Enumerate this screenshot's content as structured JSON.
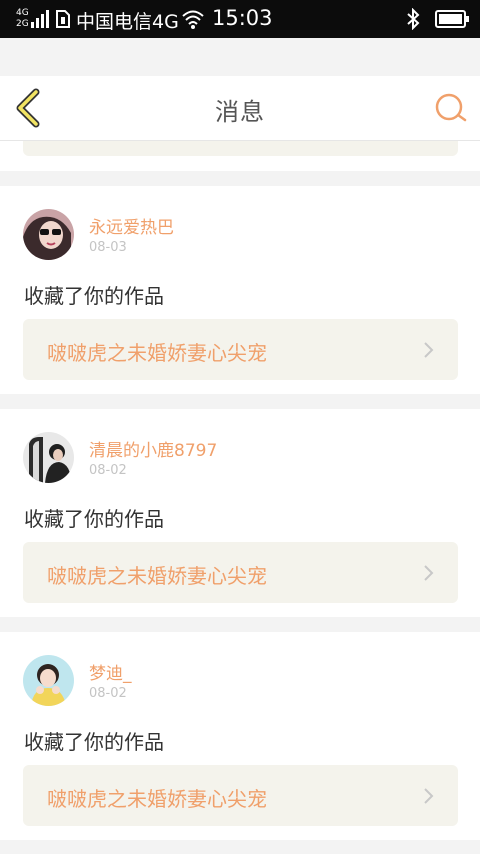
{
  "status_bar": {
    "network_top": "4G",
    "network_bottom": "2G",
    "carrier": "中国电信4G",
    "time": "15:03"
  },
  "header": {
    "title": "消息",
    "back_icon": "chevron-left-icon",
    "search_icon": "search-icon",
    "accent_color": "#f0a06b"
  },
  "messages": [
    {
      "user": "永远爱热巴",
      "date": "08-03",
      "action": "收藏了你的作品",
      "work_title": "啵啵虎之未婚娇妻心尖宠"
    },
    {
      "user": "清晨的小鹿8797",
      "date": "08-02",
      "action": "收藏了你的作品",
      "work_title": "啵啵虎之未婚娇妻心尖宠"
    },
    {
      "user": "梦迪_",
      "date": "08-02",
      "action": "收藏了你的作品",
      "work_title": "啵啵虎之未婚娇妻心尖宠"
    }
  ]
}
